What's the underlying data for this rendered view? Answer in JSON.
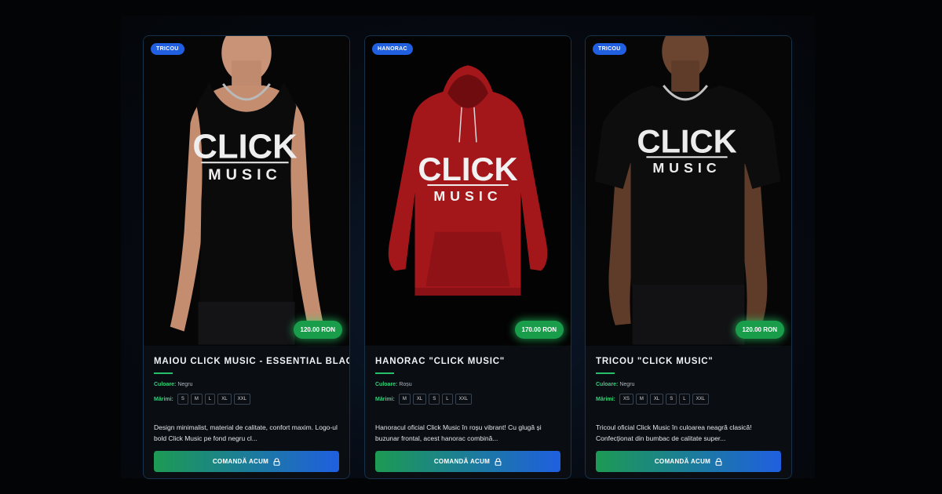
{
  "products": [
    {
      "badge": "TRICOU",
      "price": "120.00 RON",
      "title": "MAIOU CLICK MUSIC - ESSENTIAL BLACK",
      "color_label": "Culoare:",
      "color_value": "Negru",
      "sizes_label": "Mărimi:",
      "sizes": [
        "S",
        "M",
        "L",
        "XL",
        "XXL"
      ],
      "description": "Design minimalist, material de calitate, confort maxim. Logo-ul bold Click Music pe fond negru cl...",
      "cta": "COMANDĂ ACUM",
      "logo_top": "CLICK",
      "logo_bottom": "MUSIC",
      "garment_color": "#0b0b0c"
    },
    {
      "badge": "HANORAC",
      "price": "170.00 RON",
      "title": "HANORAC \"CLICK MUSIC\"",
      "color_label": "Culoare:",
      "color_value": "Roșu",
      "sizes_label": "Mărimi:",
      "sizes": [
        "M",
        "XL",
        "S",
        "L",
        "XXL"
      ],
      "description": "Hanoracul oficial Click Music în roșu vibrant! Cu glugă și buzunar frontal, acest hanorac combină...",
      "cta": "COMANDĂ ACUM",
      "logo_top": "CLICK",
      "logo_bottom": "MUSIC",
      "garment_color": "#a3161a"
    },
    {
      "badge": "TRICOU",
      "price": "120.00 RON",
      "title": "TRICOU \"CLICK MUSIC\"",
      "color_label": "Culoare:",
      "color_value": "Negru",
      "sizes_label": "Mărimi:",
      "sizes": [
        "XS",
        "M",
        "XL",
        "S",
        "L",
        "XXL"
      ],
      "description": "Tricoul oficial Click Music în culoarea neagră clasică! Confecționat din bumbac de calitate super...",
      "cta": "COMANDĂ ACUM",
      "logo_top": "CLICK",
      "logo_bottom": "MUSIC",
      "garment_color": "#0d0d0e"
    }
  ]
}
